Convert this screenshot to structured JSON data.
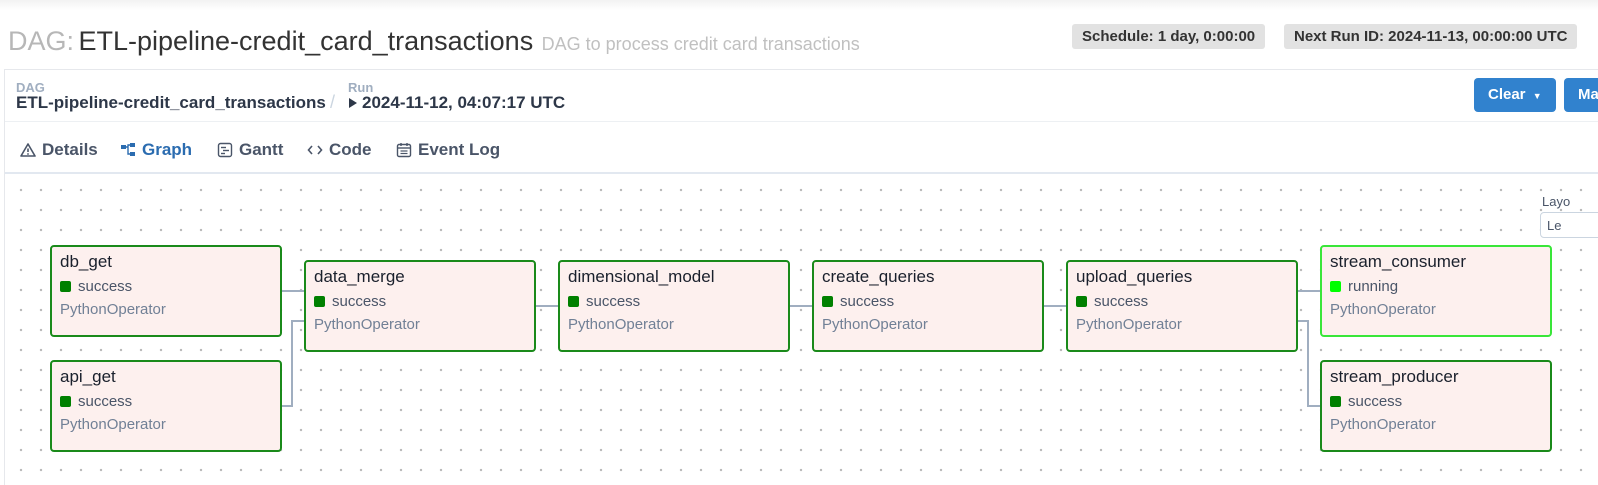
{
  "header": {
    "dag_prefix": "DAG:",
    "dag_name": "ETL-pipeline-credit_card_transactions",
    "dag_description": "DAG to process credit card transactions",
    "schedule_badge": "Schedule: 1 day, 0:00:00",
    "next_run_badge": "Next Run ID: 2024-11-13, 00:00:00 UTC"
  },
  "breadcrumb": {
    "dag_label": "DAG",
    "dag_value": "ETL-pipeline-credit_card_transactions",
    "separator": "/",
    "run_label": "Run",
    "run_value": "2024-11-12, 04:07:17 UTC"
  },
  "actions": {
    "clear_label": "Clear",
    "mark_label": "Ma"
  },
  "tabs": [
    {
      "label": "Details",
      "icon": "warning-triangle-icon"
    },
    {
      "label": "Graph",
      "icon": "graph-icon"
    },
    {
      "label": "Gantt",
      "icon": "gantt-icon"
    },
    {
      "label": "Code",
      "icon": "code-icon"
    },
    {
      "label": "Event Log",
      "icon": "calendar-icon"
    }
  ],
  "active_tab": "Graph",
  "layout": {
    "label": "Layo",
    "select_value": "Le"
  },
  "nodes": [
    {
      "id": "db_get",
      "name": "db_get",
      "state": "success",
      "operator": "PythonOperator"
    },
    {
      "id": "api_get",
      "name": "api_get",
      "state": "success",
      "operator": "PythonOperator"
    },
    {
      "id": "data_merge",
      "name": "data_merge",
      "state": "success",
      "operator": "PythonOperator"
    },
    {
      "id": "dimensional_model",
      "name": "dimensional_model",
      "state": "success",
      "operator": "PythonOperator"
    },
    {
      "id": "create_queries",
      "name": "create_queries",
      "state": "success",
      "operator": "PythonOperator"
    },
    {
      "id": "upload_queries",
      "name": "upload_queries",
      "state": "success",
      "operator": "PythonOperator"
    },
    {
      "id": "stream_consumer",
      "name": "stream_consumer",
      "state": "running",
      "operator": "PythonOperator"
    },
    {
      "id": "stream_producer",
      "name": "stream_producer",
      "state": "success",
      "operator": "PythonOperator"
    }
  ],
  "colors": {
    "accent": "#3182ce",
    "success": "#008000",
    "running": "#00ff00",
    "node_fill": "#fdf0ee"
  }
}
